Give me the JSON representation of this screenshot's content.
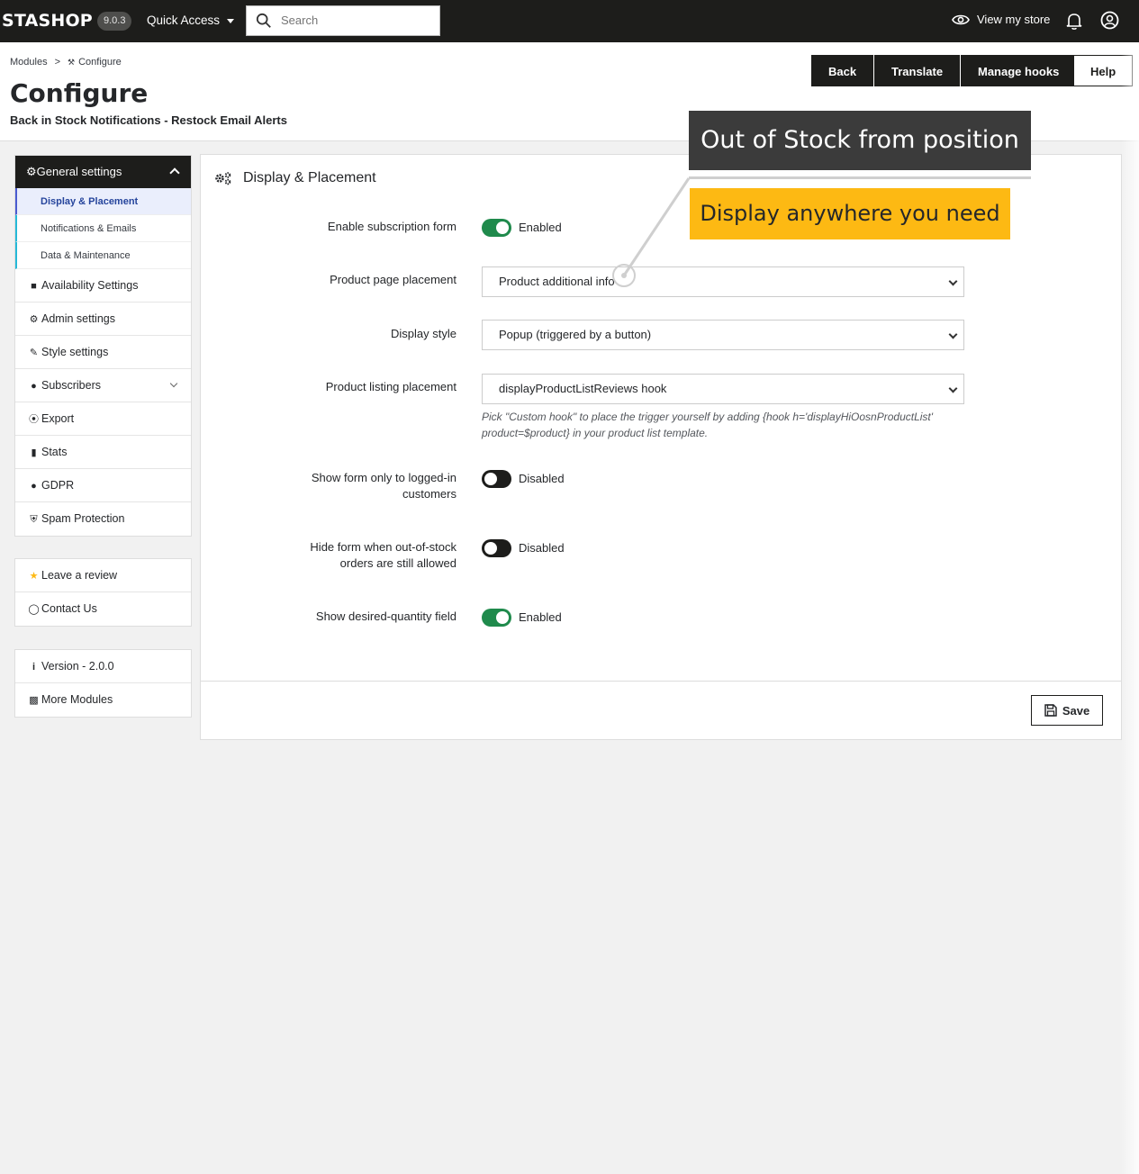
{
  "topbar": {
    "logo": "STASHOP",
    "version": "9.0.3",
    "quick_access": "Quick Access",
    "search_placeholder": "Search",
    "view_store": "View my store"
  },
  "header": {
    "breadcrumb": [
      "Modules",
      "Configure"
    ],
    "title": "Configure",
    "subtitle": "Back in Stock Notifications - Restock Email Alerts",
    "buttons": [
      "Back",
      "Translate",
      "Manage hooks",
      "Help"
    ]
  },
  "sidebar": {
    "general": {
      "label": "General settings",
      "subitems": [
        "Display & Placement",
        "Notifications & Emails",
        "Data & Maintenance"
      ]
    },
    "items": [
      {
        "icon": "folder-icon",
        "label": "Availability Settings"
      },
      {
        "icon": "gear-icon",
        "label": "Admin settings"
      },
      {
        "icon": "brush-icon",
        "label": "Style settings"
      },
      {
        "icon": "user-icon",
        "label": "Subscribers"
      },
      {
        "icon": "export-icon",
        "label": "Export"
      },
      {
        "icon": "bar-chart-icon",
        "label": "Stats"
      },
      {
        "icon": "user-icon",
        "label": "GDPR"
      },
      {
        "icon": "shield-icon",
        "label": "Spam Protection"
      }
    ],
    "support": [
      {
        "icon": "star-icon",
        "label": "Leave a review"
      },
      {
        "icon": "lifebuoy-icon",
        "label": "Contact Us"
      }
    ],
    "info": [
      {
        "icon": "info-icon",
        "label": "Version - 2.0.0"
      },
      {
        "icon": "puzzle-icon",
        "label": "More Modules"
      }
    ]
  },
  "panel": {
    "title": "Display & Placement",
    "fields": {
      "enable_form": {
        "label": "Enable subscription form",
        "state": "Enabled"
      },
      "product_page_placement": {
        "label": "Product page placement",
        "value": "Product additional info"
      },
      "display_style": {
        "label": "Display style",
        "value": "Popup (triggered by a button)"
      },
      "listing_placement": {
        "label": "Product listing placement",
        "value": "displayProductListReviews hook",
        "help": "Pick \"Custom hook\" to place the trigger yourself by adding {hook h='displayHiOosnProductList' product=$product} in your product list template."
      },
      "logged_in_only": {
        "label": "Show form only to logged-in customers",
        "state": "Disabled"
      },
      "hide_when_orders_allowed": {
        "label": "Hide form when out-of-stock orders are still allowed",
        "state": "Disabled"
      },
      "desired_qty": {
        "label": "Show desired-quantity field",
        "state": "Enabled"
      }
    },
    "save_label": "Save"
  },
  "callouts": {
    "dark": "Out of Stock from position",
    "yellow": "Display anywhere you need"
  },
  "colors": {
    "topbar": "#1d1d1b",
    "toggle_on": "#1f8a4c",
    "callout_yellow": "#fdb913",
    "callout_dark": "#3b3b3b",
    "active_sub": "#eaeefc"
  }
}
